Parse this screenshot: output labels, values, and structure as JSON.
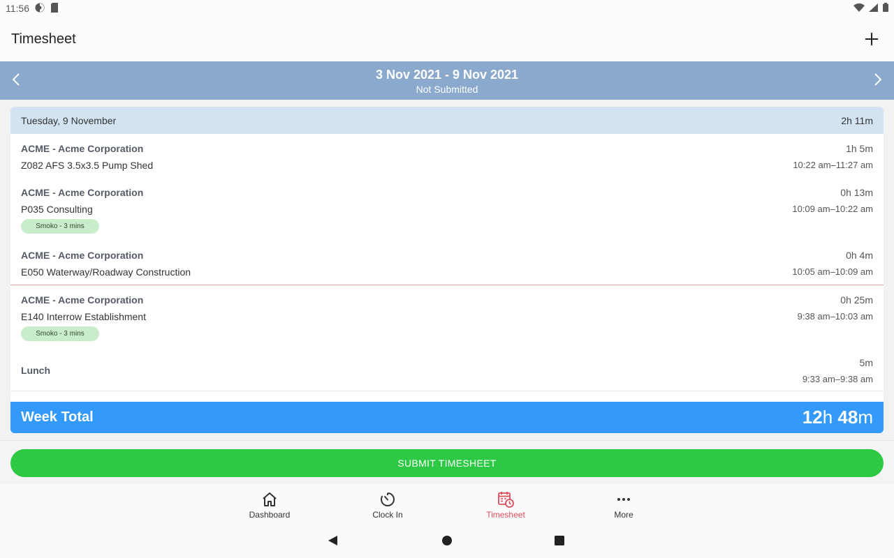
{
  "status_bar": {
    "time": "11:56"
  },
  "app_bar": {
    "title": "Timesheet"
  },
  "week": {
    "range": "3 Nov 2021 - 9 Nov 2021",
    "status": "Not Submitted"
  },
  "day": {
    "label": "Tuesday, 9 November",
    "total": "2h 11m"
  },
  "entries": [
    {
      "client": "ACME - Acme Corporation",
      "job": "Z082 AFS 3.5x3.5 Pump Shed",
      "duration": "1h 5m",
      "time": "10:22 am–11:27 am",
      "badge": ""
    },
    {
      "client": "ACME - Acme Corporation",
      "job": "P035 Consulting",
      "duration": "0h 13m",
      "time": "10:09 am–10:22 am",
      "badge": "Smoko - 3 mins"
    },
    {
      "client": "ACME - Acme Corporation",
      "job": "E050 Waterway/Roadway Construction",
      "duration": "0h 4m",
      "time": "10:05 am–10:09 am",
      "badge": ""
    },
    {
      "client": "ACME - Acme Corporation",
      "job": "E140  Interrow Establishment",
      "duration": "0h 25m",
      "time": "9:38 am–10:03 am",
      "badge": "Smoko - 3 mins"
    },
    {
      "client": "Lunch",
      "job": "",
      "duration": "5m",
      "time": "9:33 am–9:38 am",
      "badge": ""
    }
  ],
  "week_total": {
    "label": "Week Total",
    "hours": "12",
    "hours_unit": "h",
    "minutes": "48",
    "minutes_unit": "m"
  },
  "submit": {
    "label": "SUBMIT TIMESHEET"
  },
  "bottom_nav": [
    {
      "label": "Dashboard",
      "icon": "home-icon"
    },
    {
      "label": "Clock In",
      "icon": "timer-icon"
    },
    {
      "label": "Timesheet",
      "icon": "calendar-clock-icon",
      "active": true
    },
    {
      "label": "More",
      "icon": "more-dots-icon"
    }
  ],
  "colors": {
    "accent": "#3399fa",
    "submit": "#2dc944",
    "active_nav": "#e04c5a",
    "week_header": "#8aa9cd",
    "day_header": "#d3e3f2",
    "badge": "#c9ecca"
  }
}
